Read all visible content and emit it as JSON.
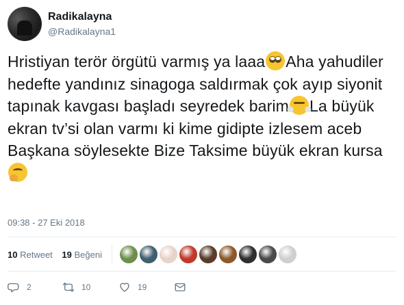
{
  "user": {
    "display_name": "Radikalayna",
    "handle": "@Radikalayna1"
  },
  "tweet": {
    "part1": "Hristiyan terör örgütü varmış ya laaa",
    "part2": "Aha yahudiler hedefte yandınız sinagoga saldırmak çok ayıp siyonit tapınak kavgası başladı seyredek barim",
    "part3": "La büyük ekran tv’si olan varmı ki kime gidipte izlesem aceb Başkana söylesekte Bize Taksime büyük ekran kursa",
    "emojis": [
      "face-with-rolling-eyes-emoji",
      "face-with-steam-emoji",
      "thinking-face-emoji"
    ]
  },
  "timestamp": "09:38 - 27 Eki 2018",
  "stats": {
    "retweets_count": "10",
    "retweets_label": "Retweet",
    "likes_count": "19",
    "likes_label": "Beğeni"
  },
  "likers_colors": [
    "#6d8f4e",
    "#3f5f6e",
    "#e7d3c8",
    "#c0392b",
    "#5a3b2a",
    "#8a5a2b",
    "#2f2f2f",
    "#4a4a4a",
    "#cfcfcf"
  ],
  "actions": {
    "reply_count": "2",
    "retweet_count": "10",
    "like_count": "19"
  },
  "colors": {
    "text": "#14171a",
    "secondary": "#657786",
    "divider": "#e6ecf0"
  }
}
